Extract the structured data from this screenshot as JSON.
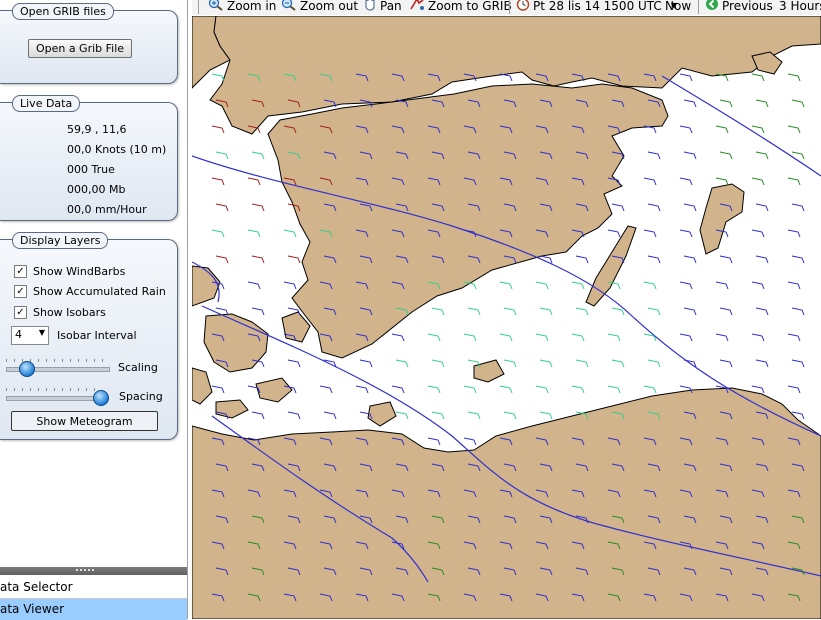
{
  "open_grib": {
    "title": "Open GRIB files",
    "button": "Open a Grib File"
  },
  "live_data": {
    "title": "Live Data",
    "position": "59,9 ,  11,6",
    "wind_speed": "00,0 Knots (10 m)",
    "wind_direction": "000 True",
    "pressure": "000,00 Mb",
    "rain": "00,0 mm/Hour"
  },
  "display_layers": {
    "title": "Display Layers",
    "windbarbs": {
      "label": "Show WindBarbs",
      "checked": true
    },
    "rain": {
      "label": "Show Accumulated Rain",
      "checked": true
    },
    "isobars": {
      "label": "Show Isobars",
      "checked": true
    },
    "isobar_interval": {
      "value": "4",
      "label": "Isobar Interval"
    },
    "scaling": {
      "label": "Scaling",
      "value": 0.19
    },
    "spacing": {
      "label": "Spacing",
      "value": 1.0
    },
    "meteogram_button": "Show Meteogram"
  },
  "bottom_tabs": {
    "data_selector": "ata Selector",
    "data_viewer": "ata Viewer"
  },
  "toolbar": {
    "zoom_in": "Zoom in",
    "zoom_out": "Zoom out",
    "pan": "Pan",
    "zoom_to_grib": "Zoom to GRIB",
    "time": "Pt 28 lis 14 1500 UTC",
    "now": "Now",
    "previous": "Previous",
    "step": "3 Hours",
    "icons": [
      "zoom-in-icon",
      "zoom-out-icon",
      "pan-hand-icon",
      "zoom-to-grib-icon",
      "clock-icon",
      "dropdown-arrow-icon",
      "previous-green-arrow-icon"
    ]
  },
  "colors": {
    "land": "#d2b48c",
    "sea": "#ffffff",
    "isobar": "#3030d0",
    "barb_blue": "#2a2ad0",
    "barb_green": "#1f8a1f",
    "barb_aqua": "#2fd08a",
    "barb_red": "#a01a1a",
    "selected_tab": "#99ccff"
  }
}
